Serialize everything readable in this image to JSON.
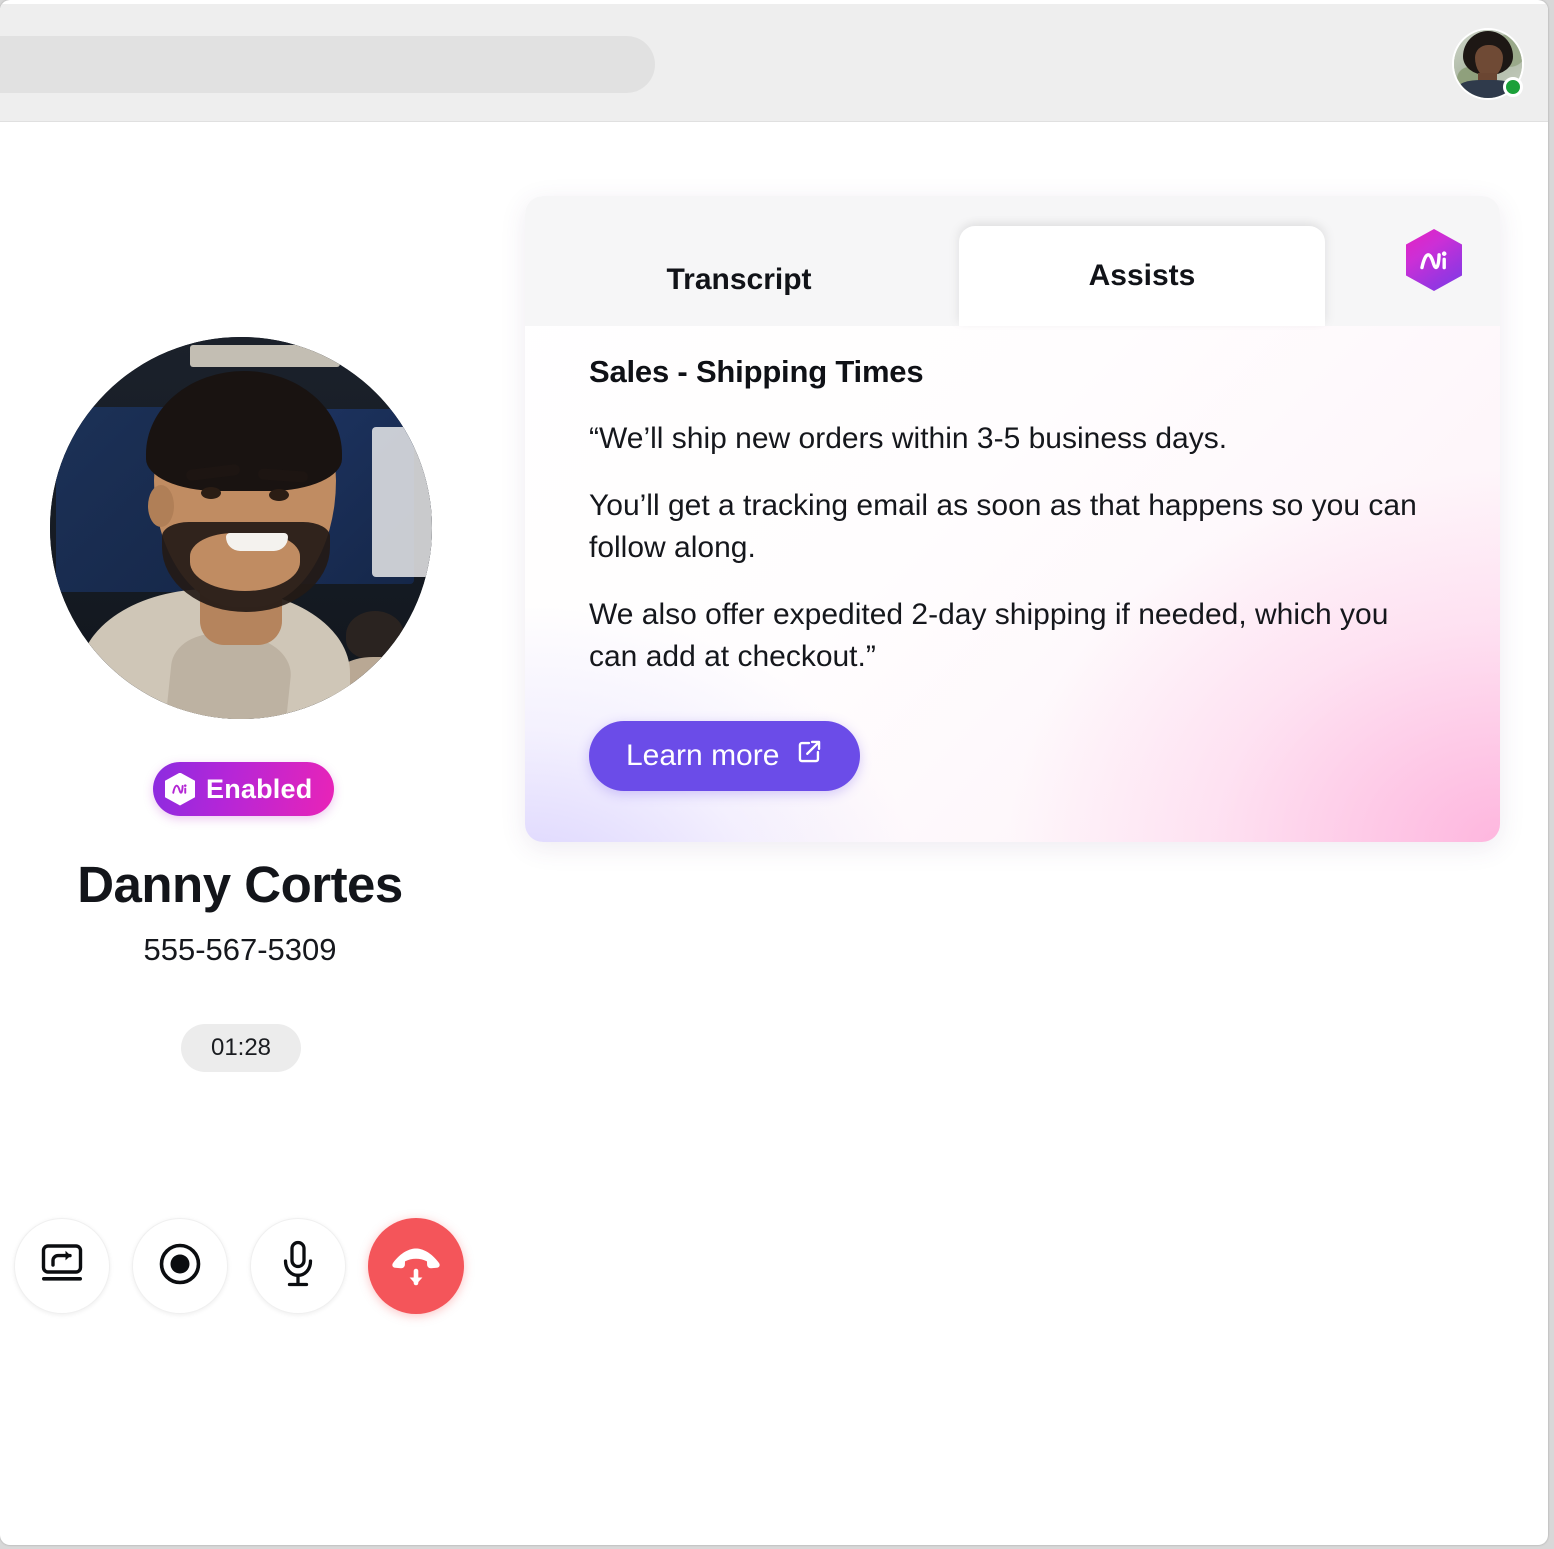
{
  "topbar": {
    "search_placeholder": "",
    "search_value": "",
    "avatar_name": "agent-avatar",
    "status": "online"
  },
  "caller": {
    "name": "Danny Cortes",
    "phone": "555-567-5309",
    "timer": "01:28",
    "badge_label": "Enabled",
    "photo_alt": "Danny Cortes"
  },
  "controls": [
    {
      "name": "transfer-call",
      "label": "Transfer"
    },
    {
      "name": "record-call",
      "label": "Record"
    },
    {
      "name": "mute-microphone",
      "label": "Mute"
    },
    {
      "name": "end-call",
      "label": "End call"
    }
  ],
  "assist_panel": {
    "tabs": [
      {
        "id": "transcript",
        "label": "Transcript",
        "active": false
      },
      {
        "id": "assists",
        "label": "Assists",
        "active": true
      }
    ],
    "brand_icon": "ai-hexagon-icon",
    "title": "Sales - Shipping Times",
    "paragraphs": [
      "“We’ll ship new orders within 3-5 business days.",
      "You’ll get a tracking email as soon as that happens so you can follow along.",
      "We also offer expedited 2-day shipping if needed, which you can add at checkout.”"
    ],
    "cta_label": "Learn more",
    "cta_icon": "external-link-icon"
  },
  "colors": {
    "accent_purple": "#6b4ce8",
    "brand_magenta": "#e622c0",
    "end_call_red": "#f4555a",
    "status_green": "#1ba039",
    "topbar_grey": "#eeeeee"
  }
}
